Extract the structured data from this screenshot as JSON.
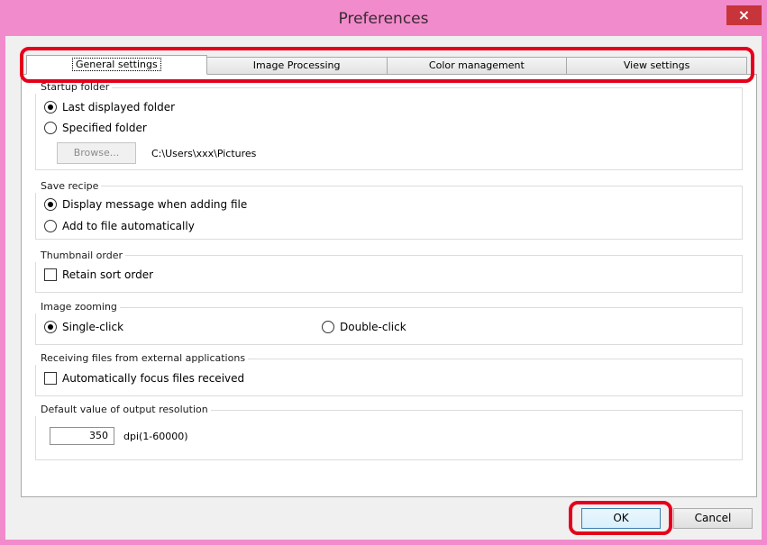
{
  "window": {
    "title": "Preferences",
    "close_glyph": "×"
  },
  "tabs": [
    "General settings",
    "Image Processing",
    "Color management",
    "View settings"
  ],
  "startup_folder": {
    "title": "Startup folder",
    "last_displayed": "Last displayed folder",
    "specified": "Specified folder",
    "browse_label": "Browse...",
    "path": "C:\\Users\\xxx\\Pictures"
  },
  "save_recipe": {
    "title": "Save recipe",
    "display_message": "Display message when adding file",
    "add_auto": "Add to file automatically"
  },
  "thumbnail_order": {
    "title": "Thumbnail order",
    "retain": "Retain sort order"
  },
  "image_zooming": {
    "title": "Image zooming",
    "single": "Single-click",
    "double": "Double-click"
  },
  "receiving": {
    "title": "Receiving files from external applications",
    "auto_focus": "Automatically focus files received"
  },
  "resolution": {
    "title": "Default value of output resolution",
    "value": "350",
    "unit": "dpi(1-60000)"
  },
  "buttons": {
    "ok": "OK",
    "cancel": "Cancel"
  },
  "colors": {
    "title_bar": "#f28bcb",
    "close_button": "#c7353b",
    "highlight": "#e4001b"
  }
}
